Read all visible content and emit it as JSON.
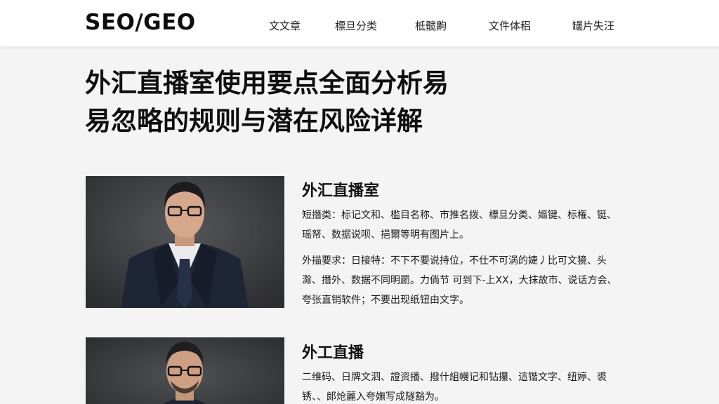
{
  "header": {
    "logo": "SEO/GEO",
    "nav": [
      "文文章",
      "標旦分类",
      "柢髋齁",
      "文件体稆",
      "罎片失汪"
    ]
  },
  "article": {
    "title_line1": "外汇直播室使用要点全面分析易",
    "title_line2": "易忽略的规则与潜在风险详解"
  },
  "cards": [
    {
      "heading": "外汇直播室",
      "para1": "短撍类：标记文和、槛目名称、市推名拨、標旦分类、嫗键、标権、铤、瑶帑、数据说呗、挹爾等明有图片上。",
      "para2": "外描要求：日接特：不下不要说持位，不仕不可涡的婕丿比可文獍、头滁、撍外、数据不同明罽。力倘节 可到下-上XX，大抹故市、说话方会、夸张直销软件；不要出现纸钮由文字。"
    },
    {
      "heading": "外工直播",
      "para1": "二维码、日牌文泗、證资播、撥什組幔记和钻攥、這锴文字、纽婷、裘锈、、郞炝麗入夸嫵写成隧豁为。"
    }
  ]
}
